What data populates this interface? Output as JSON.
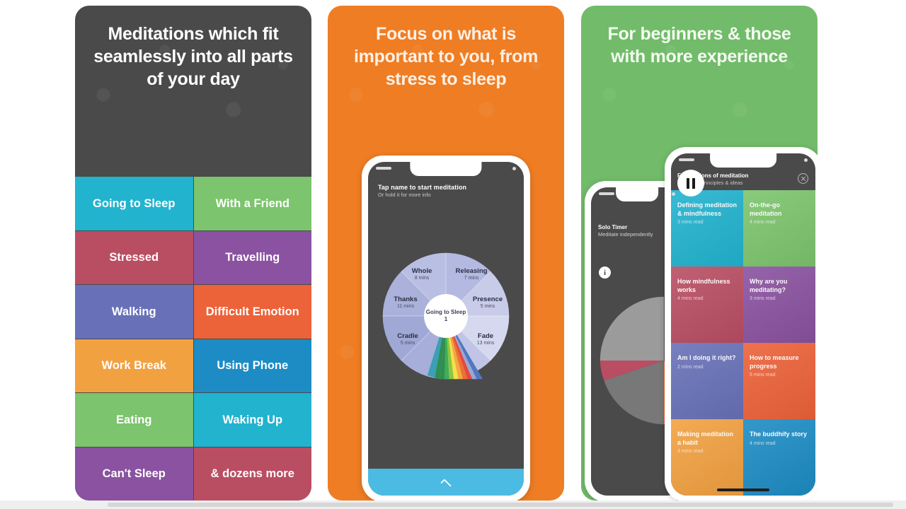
{
  "panels": [
    {
      "id": "panel-moments",
      "headline": "Meditations which fit seamlessly into all parts of your day",
      "background_color": "#4a4a4a",
      "tiles": [
        {
          "label": "Going to Sleep",
          "color": "#22b3cf"
        },
        {
          "label": "With a Friend",
          "color": "#7cc46d"
        },
        {
          "label": "Stressed",
          "color": "#b94e63"
        },
        {
          "label": "Travelling",
          "color": "#8a52a0"
        },
        {
          "label": "Walking",
          "color": "#6871b8"
        },
        {
          "label": "Difficult Emotion",
          "color": "#ec6239"
        },
        {
          "label": "Work Break",
          "color": "#f2a141"
        },
        {
          "label": "Using Phone",
          "color": "#1d8cc4"
        },
        {
          "label": "Eating",
          "color": "#7cc46d"
        },
        {
          "label": "Waking Up",
          "color": "#22b3cf"
        },
        {
          "label": "Can't Sleep",
          "color": "#8a52a0"
        },
        {
          "label": "& dozens more",
          "color": "#b94e63"
        }
      ]
    },
    {
      "id": "panel-focus",
      "headline": "Focus on what is important to you, from stress to sleep",
      "background_color": "#ef7d24",
      "screen": {
        "title": "Tap name to start meditation",
        "subtitle": "Or hold it for more info",
        "hub_label": "Going to Sleep 1",
        "bottom_bar_color": "#4cbbe3",
        "bottom_bar_icon": "chevron-up-icon",
        "wheel": [
          {
            "name": "Releasing",
            "duration": "7 mins"
          },
          {
            "name": "Presence",
            "duration": "5 mins"
          },
          {
            "name": "Fade",
            "duration": "13 mins"
          },
          {
            "name": "Cradle",
            "duration": "5 mins"
          },
          {
            "name": "Thanks",
            "duration": "11 mins"
          },
          {
            "name": "Whole",
            "duration": "8 mins"
          }
        ]
      }
    },
    {
      "id": "panel-experience",
      "headline": "For beginners & those with more experience",
      "background_color": "#72bb6a",
      "solo_timer": {
        "title": "Solo Timer",
        "subtitle": "Meditate independently",
        "info_icon": "info-icon",
        "pause_icon": "pause-icon"
      },
      "cards_screen": {
        "title": "Foundations of meditation",
        "subtitle": "Important principles & ideas",
        "close_icon": "close-circle-icon",
        "cards": [
          {
            "title": "Defining meditation & mindfulness",
            "meta": "3 mins read",
            "color": "#22b3cf"
          },
          {
            "title": "On-the-go meditation",
            "meta": "4 mins read",
            "color": "#7cc46d"
          },
          {
            "title": "How mindfulness works",
            "meta": "4 mins read",
            "color": "#b94e63"
          },
          {
            "title": "Why are you meditating?",
            "meta": "3 mins read",
            "color": "#8a52a0"
          },
          {
            "title": "Am I doing it right?",
            "meta": "2 mins read",
            "color": "#6871b8"
          },
          {
            "title": "How to measure progress",
            "meta": "5 mins read",
            "color": "#ec6239"
          },
          {
            "title": "Making meditation a habit",
            "meta": "3 mins read",
            "color": "#f2a141"
          },
          {
            "title": "The buddhify story",
            "meta": "4 mins read",
            "color": "#1d8cc4"
          }
        ]
      }
    }
  ]
}
